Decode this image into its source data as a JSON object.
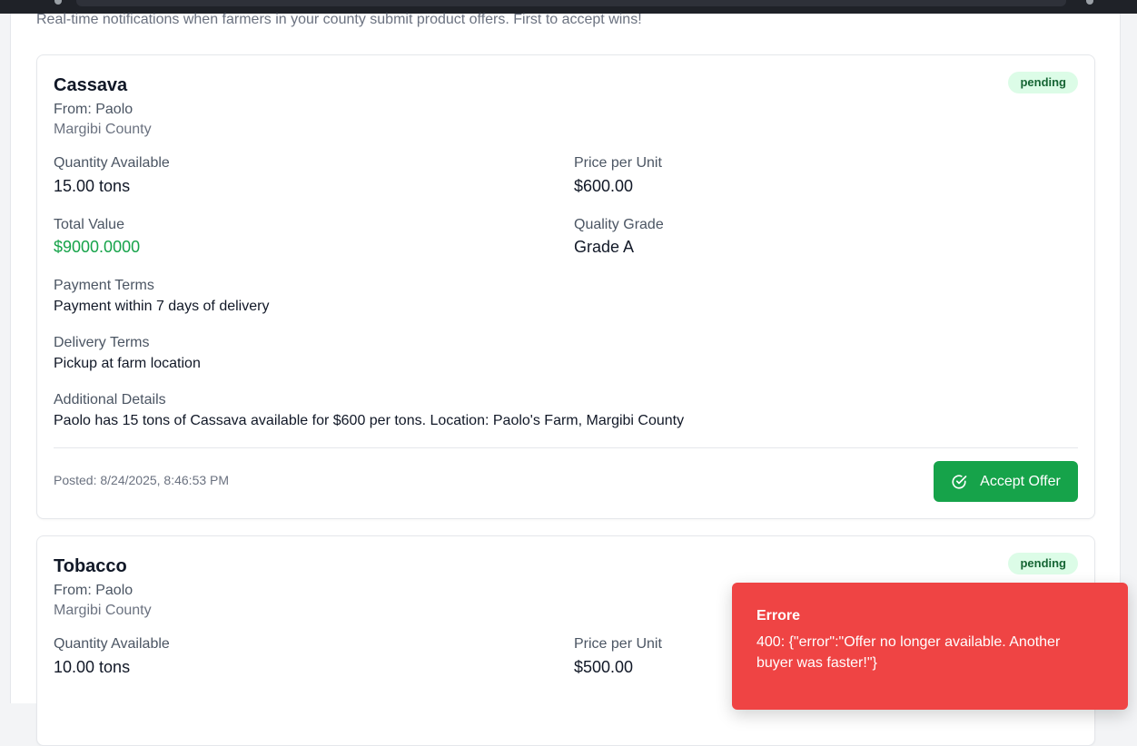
{
  "page": {
    "subtitle": "Real-time notifications when farmers in your county submit product offers. First to accept wins!"
  },
  "offers": [
    {
      "product": "Cassava",
      "status": "pending",
      "from": "From: Paolo",
      "county": "Margibi County",
      "quantity_label": "Quantity Available",
      "quantity": "15.00 tons",
      "price_label": "Price per Unit",
      "price": "$600.00",
      "total_label": "Total Value",
      "total": "$9000.0000",
      "grade_label": "Quality Grade",
      "grade": "Grade A",
      "payment_label": "Payment Terms",
      "payment": "Payment within 7 days of delivery",
      "delivery_label": "Delivery Terms",
      "delivery": "Pickup at farm location",
      "details_label": "Additional Details",
      "details": "Paolo has 15 tons of Cassava available for $600 per tons. Location: Paolo's Farm, Margibi County",
      "posted": "Posted: 8/24/2025, 8:46:53 PM",
      "accept_label": "Accept Offer"
    },
    {
      "product": "Tobacco",
      "status": "pending",
      "from": "From: Paolo",
      "county": "Margibi County",
      "quantity_label": "Quantity Available",
      "quantity": "10.00 tons",
      "price_label": "Price per Unit",
      "price": "$500.00"
    }
  ],
  "toast": {
    "title": "Errore",
    "message": "400: {\"error\":\"Offer no longer available. Another buyer was faster!\"}"
  },
  "colors": {
    "accept_green": "#16a34a",
    "badge_bg": "#dcfce7",
    "badge_text": "#166534",
    "toast_red": "#ef4444"
  },
  "icons": {
    "accept": "check-circle-icon"
  }
}
